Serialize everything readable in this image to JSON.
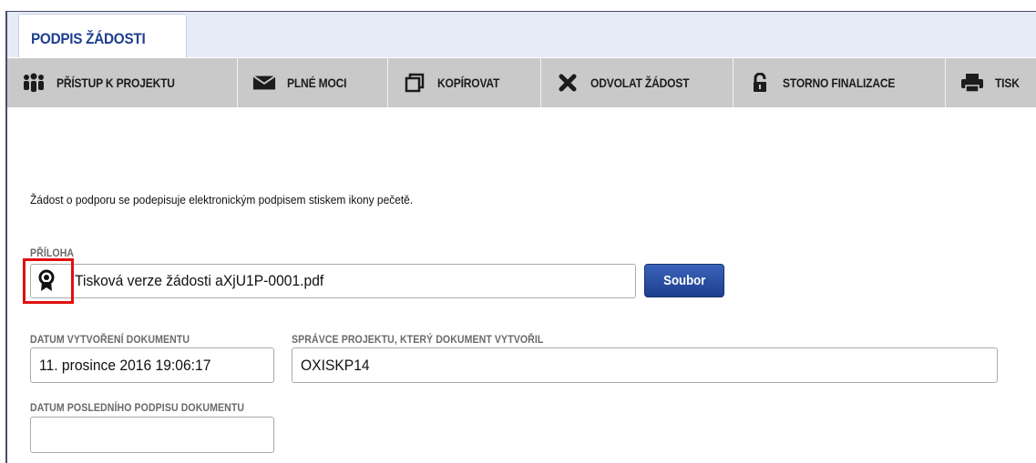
{
  "tab": {
    "label": "PODPIS ŽÁDOSTI"
  },
  "toolbar": {
    "buttons": [
      {
        "label": "PŘÍSTUP K PROJEKTU",
        "icon": "people-icon"
      },
      {
        "label": "PLNÉ MOCI",
        "icon": "envelope-icon"
      },
      {
        "label": "KOPÍROVAT",
        "icon": "copy-icon"
      },
      {
        "label": "ODVOLAT ŽÁDOST",
        "icon": "close-icon"
      },
      {
        "label": "STORNO FINALIZACE",
        "icon": "unlock-icon"
      },
      {
        "label": "TISK",
        "icon": "printer-icon"
      }
    ]
  },
  "info_text": "Žádost o podporu se podepisuje elektronickým podpisem stiskem ikony pečetě.",
  "attachment": {
    "label": "PŘÍLOHA",
    "value": "Tisková verze žádosti aXjU1P-0001.pdf",
    "seal_icon": "seal-icon",
    "button_label": "Soubor"
  },
  "created": {
    "label": "DATUM VYTVOŘENÍ DOKUMENTU",
    "value": "11. prosince 2016 19:06:17"
  },
  "author": {
    "label": "SPRÁVCE PROJEKTU, KTERÝ DOKUMENT VYTVOŘIL",
    "value": "OXISKP14"
  },
  "last_signed": {
    "label": "DATUM POSLEDNÍHO PODPISU DOKUMENTU",
    "value": ""
  },
  "colors": {
    "tab_text": "#1f3f8f",
    "toolbar_bg": "#c9c9c9",
    "button_bg": "#1d3f8f",
    "highlight": "#e01010"
  }
}
